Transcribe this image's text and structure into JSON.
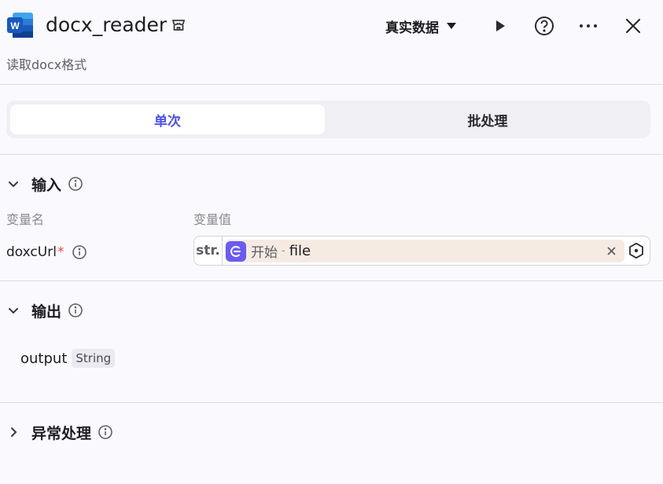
{
  "header": {
    "title": "docx_reader",
    "subtitle": "读取docx格式",
    "data_select_label": "真实数据",
    "app_icon_letter": "W",
    "icons": [
      "word-app-icon",
      "store-icon",
      "caret-down-icon",
      "play-icon",
      "help-icon",
      "more-icon",
      "close-icon"
    ]
  },
  "tabs": [
    {
      "label": "单次",
      "active": true
    },
    {
      "label": "批处理",
      "active": false
    }
  ],
  "input": {
    "section_label": "输入",
    "col_name_label": "变量名",
    "col_value_label": "变量值",
    "params": [
      {
        "name": "doxcUrl",
        "required_mark": "*",
        "type_tag": "str.",
        "ref_node": "开始",
        "ref_sep": "-",
        "ref_field": "file"
      }
    ]
  },
  "output": {
    "section_label": "输出",
    "fields": [
      {
        "name": "output",
        "type": "String"
      }
    ]
  },
  "exception": {
    "section_label": "异常处理"
  },
  "colors": {
    "accent": "#4d53e8",
    "node_icon_bg": "#6a5cf0",
    "ref_chip_bg": "#f6ebe3",
    "word_blue": "#2b579a",
    "required": "#e5484d"
  }
}
